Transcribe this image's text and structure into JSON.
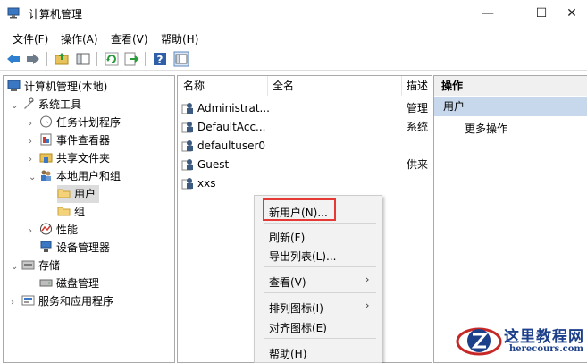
{
  "window": {
    "title": "计算机管理",
    "controls": {
      "minimize": "—",
      "maximize": "☐",
      "close": "✕"
    }
  },
  "menu": [
    "文件(F)",
    "操作(A)",
    "查看(V)",
    "帮助(H)"
  ],
  "toolbar": {
    "icons": [
      "back-icon",
      "forward-icon",
      "up-folder-icon",
      "show-tree-icon",
      "refresh-icon",
      "export-icon",
      "help-icon",
      "properties-icon"
    ]
  },
  "tree": {
    "root": "计算机管理(本地)",
    "system_tools": "系统工具",
    "task_scheduler": "任务计划程序",
    "event_viewer": "事件查看器",
    "shared_folders": "共享文件夹",
    "local_users": "本地用户和组",
    "users": "用户",
    "groups": "组",
    "performance": "性能",
    "device_manager": "设备管理器",
    "storage": "存储",
    "disk_management": "磁盘管理",
    "services_apps": "服务和应用程序"
  },
  "list": {
    "columns": [
      "名称",
      "全名",
      "描述"
    ],
    "rows": [
      {
        "name": "Administrat...",
        "fullname": "",
        "desc": "管理"
      },
      {
        "name": "DefaultAcc...",
        "fullname": "",
        "desc": "系统"
      },
      {
        "name": "defaultuser0",
        "fullname": "",
        "desc": ""
      },
      {
        "name": "Guest",
        "fullname": "",
        "desc": "供来"
      },
      {
        "name": "xxs",
        "fullname": "",
        "desc": ""
      }
    ]
  },
  "context_menu": {
    "new_user": "新用户(N)...",
    "refresh": "刷新(F)",
    "export_list": "导出列表(L)...",
    "view": "查看(V)",
    "arrange_icons": "排列图标(I)",
    "align_icons": "对齐图标(E)",
    "help": "帮助(H)",
    "submenu_arrow": "›"
  },
  "actions": {
    "header": "操作",
    "selected": "用户",
    "more": "更多操作"
  },
  "watermark": {
    "title": "这里教程网",
    "url": "herecours.com"
  },
  "colors": {
    "selection": "#c8d8ec",
    "highlight_border": "#e53935",
    "watermark": "#1c3f8a"
  }
}
